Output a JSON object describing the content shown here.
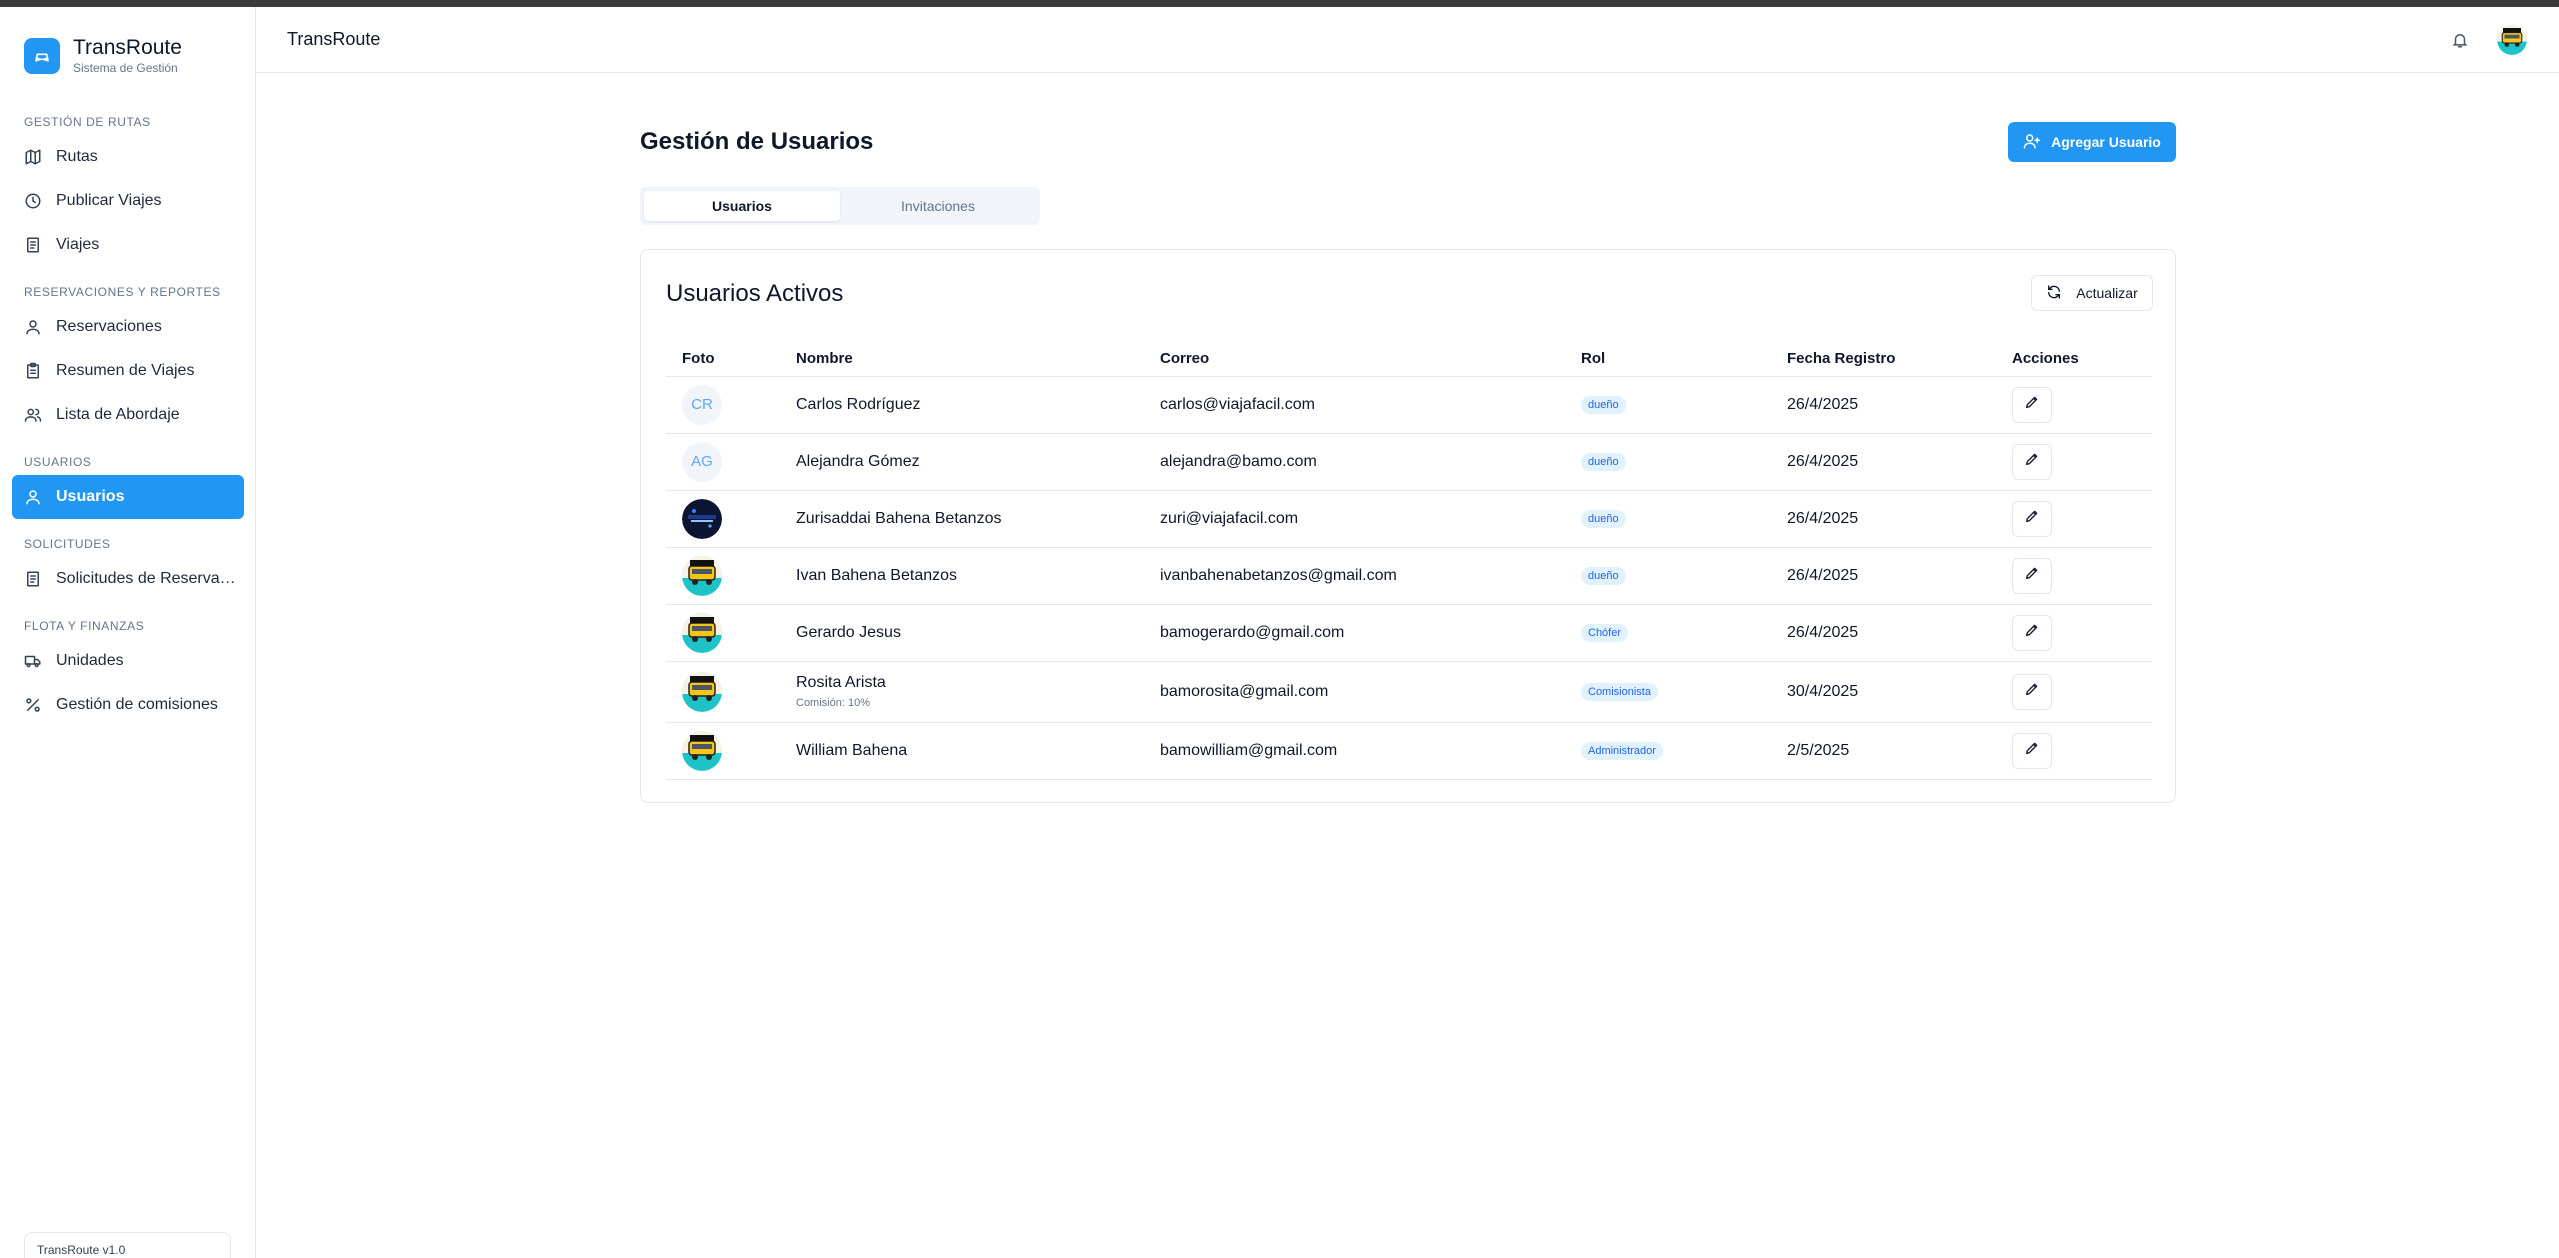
{
  "app": {
    "name": "TransRoute",
    "subtitle": "Sistema de Gestión",
    "version": "TransRoute v1.0",
    "accent_color": "#2196f3"
  },
  "header": {
    "title": "TransRoute",
    "bell_icon": "bell-icon"
  },
  "sidebar": {
    "sections": [
      {
        "title": "GESTIÓN DE RUTAS",
        "items": [
          {
            "label": "Rutas",
            "icon": "map-icon"
          },
          {
            "label": "Publicar Viajes",
            "icon": "clock-icon"
          },
          {
            "label": "Viajes",
            "icon": "receipt-icon"
          }
        ]
      },
      {
        "title": "RESERVACIONES Y REPORTES",
        "items": [
          {
            "label": "Reservaciones",
            "icon": "user-icon"
          },
          {
            "label": "Resumen de Viajes",
            "icon": "clipboard-icon"
          },
          {
            "label": "Lista de Abordaje",
            "icon": "users-icon"
          }
        ]
      },
      {
        "title": "USUARIOS",
        "items": [
          {
            "label": "Usuarios",
            "icon": "user-icon",
            "active": true
          }
        ]
      },
      {
        "title": "SOLICITUDES",
        "items": [
          {
            "label": "Solicitudes de Reservación",
            "icon": "receipt-icon"
          }
        ]
      },
      {
        "title": "FLOTA Y FINANZAS",
        "items": [
          {
            "label": "Unidades",
            "icon": "truck-icon"
          },
          {
            "label": "Gestión de comisiones",
            "icon": "percent-icon"
          }
        ]
      }
    ]
  },
  "main": {
    "title": "Gestión de Usuarios",
    "add_button": "Agregar Usuario",
    "tabs": [
      {
        "label": "Usuarios",
        "active": true
      },
      {
        "label": "Invitaciones",
        "active": false
      }
    ],
    "card": {
      "title": "Usuarios Activos",
      "refresh_button": "Actualizar",
      "columns": [
        "Foto",
        "Nombre",
        "Correo",
        "Rol",
        "Fecha Registro",
        "Acciones"
      ],
      "rows": [
        {
          "photo": "initials",
          "initials": "CR",
          "name": "Carlos Rodríguez",
          "email": "carlos@viajafacil.com",
          "role": "dueño",
          "date": "26/4/2025"
        },
        {
          "photo": "initials",
          "initials": "AG",
          "name": "Alejandra Gómez",
          "email": "alejandra@bamo.com",
          "role": "dueño",
          "date": "26/4/2025"
        },
        {
          "photo": "dark-image",
          "name": "Zurisaddai Bahena Betanzos",
          "email": "zuri@viajafacil.com",
          "role": "dueño",
          "date": "26/4/2025"
        },
        {
          "photo": "bamo-logo",
          "name": "Ivan Bahena Betanzos",
          "email": "ivanbahenabetanzos@gmail.com",
          "role": "dueño",
          "date": "26/4/2025"
        },
        {
          "photo": "bamo-logo",
          "name": "Gerardo Jesus",
          "email": "bamogerardo@gmail.com",
          "role": "Chófer",
          "date": "26/4/2025"
        },
        {
          "photo": "bamo-logo",
          "name": "Rosita Arista",
          "note": "Comisión: 10%",
          "email": "bamorosita@gmail.com",
          "role": "Comisionista",
          "date": "30/4/2025"
        },
        {
          "photo": "bamo-logo",
          "name": "William Bahena",
          "email": "bamowilliam@gmail.com",
          "role": "Administrador",
          "date": "2/5/2025"
        }
      ]
    }
  }
}
